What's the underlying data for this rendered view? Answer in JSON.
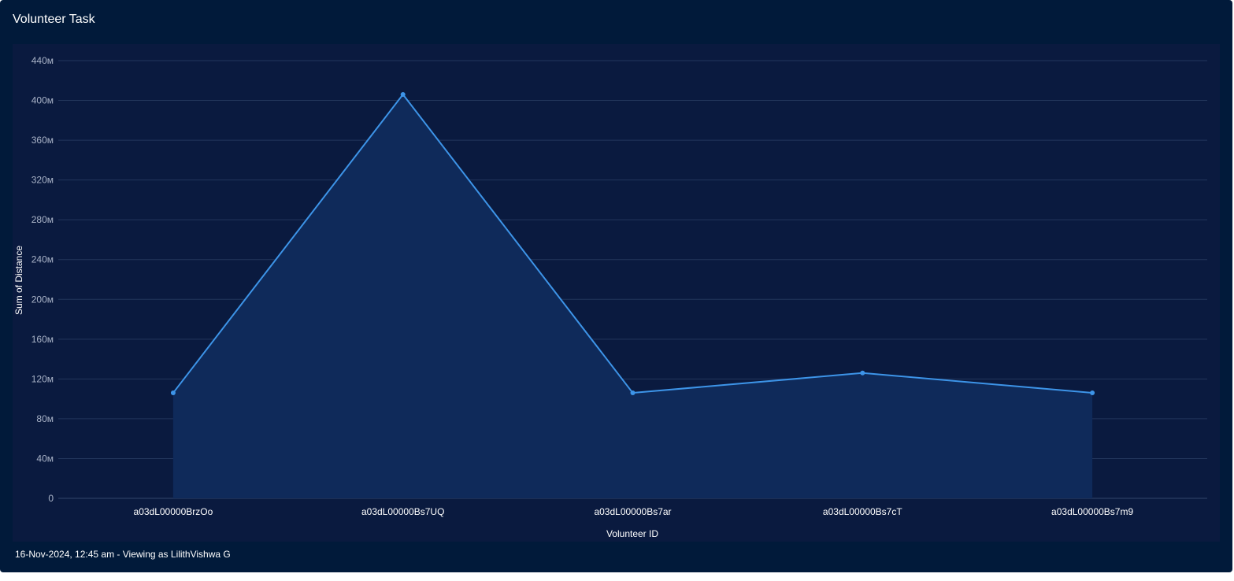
{
  "card": {
    "title": "Volunteer Task"
  },
  "footer": {
    "text": "16-Nov-2024, 12:45 am - Viewing as LilithVishwa G"
  },
  "colors": {
    "background": "#011a3a",
    "plot_background": "#0a1a3f",
    "line": "#3d94e8",
    "area_fill": "#0f2a5a",
    "grid": "#23365c"
  },
  "chart_data": {
    "type": "area",
    "title": "",
    "xlabel": "Volunteer ID",
    "ylabel": "Sum of Distance",
    "categories": [
      "a03dL00000BrzOo",
      "a03dL00000Bs7UQ",
      "a03dL00000Bs7ar",
      "a03dL00000Bs7cT",
      "a03dL00000Bs7m9"
    ],
    "series": [
      {
        "values": [
          106000000,
          406000000,
          106000000,
          126000000,
          106000000
        ]
      }
    ],
    "yticks": [
      0,
      40000000,
      80000000,
      120000000,
      160000000,
      200000000,
      240000000,
      280000000,
      320000000,
      360000000,
      400000000,
      440000000
    ],
    "ytick_labels": [
      "0",
      "40м",
      "80м",
      "120м",
      "160м",
      "200м",
      "240м",
      "280м",
      "320м",
      "360м",
      "400м",
      "440м"
    ],
    "ylim": [
      0,
      440000000
    ],
    "grid": true,
    "legend": "none"
  }
}
